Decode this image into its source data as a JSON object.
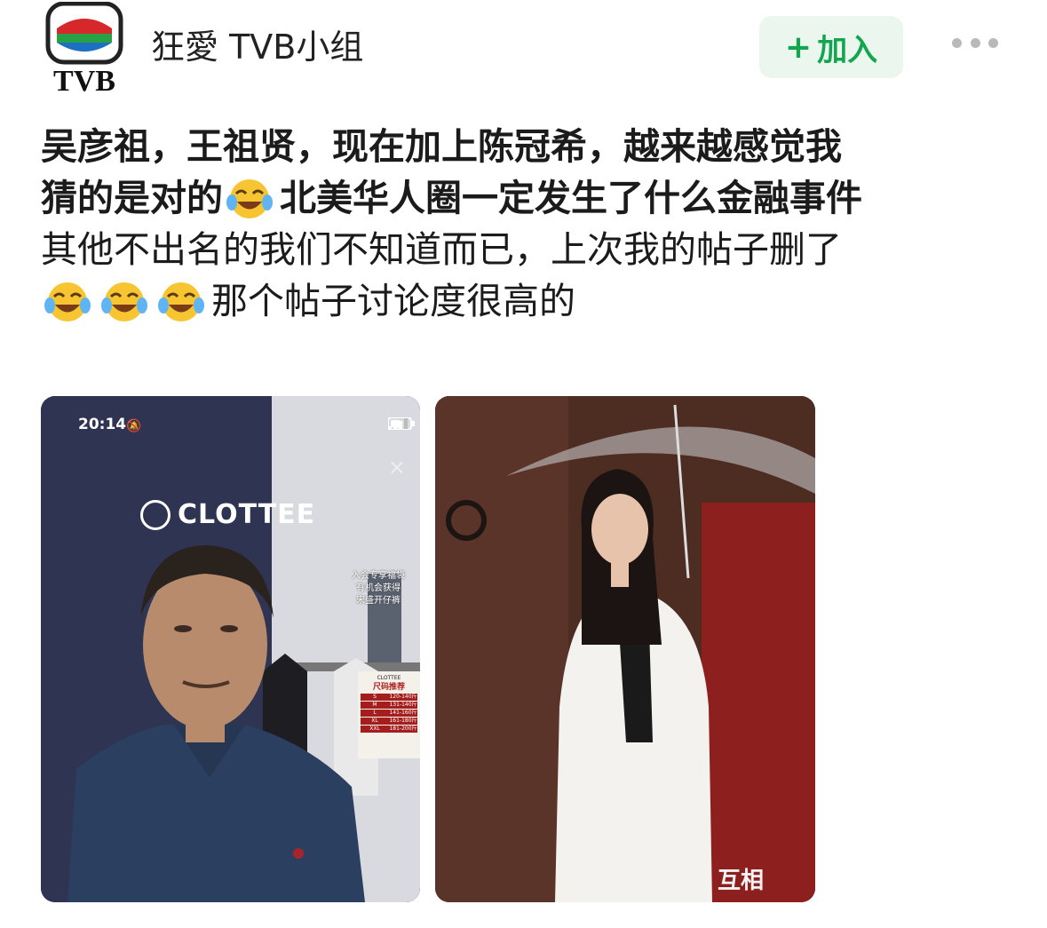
{
  "header": {
    "logo_text": "TVB",
    "group_name": "狂愛 TVB小组",
    "join_plus": "+",
    "join_label": "加入"
  },
  "post": {
    "line1": "吴彦祖，王祖贤，现在加上陈冠希，越来越感觉我",
    "line2_before": "猜的是对的",
    "line2_after": "北美华人圈一定发生了什么金融事件",
    "line3": "其他不出名的我们不知道而已，上次我的帖子删了",
    "line4_after": "那个帖子讨论度很高的",
    "emoji": "face-with-tears-of-joy-icon"
  },
  "photo1": {
    "status_time": "20:14",
    "close": "×",
    "brand": "CLOTTEE",
    "promo_lines": [
      "入会专享福袋",
      "有机会获得",
      "宋盛开仔裤"
    ],
    "size_card": {
      "brand": "CLOTTEE",
      "title": "尺码推荐",
      "rows": [
        [
          "S",
          "120-140斤"
        ],
        [
          "M",
          "131-140斤"
        ],
        [
          "L",
          "141-160斤"
        ],
        [
          "XL",
          "161-180斤"
        ],
        [
          "XXL",
          "181-200斤"
        ]
      ]
    }
  },
  "photo2": {
    "watermark": "互相"
  },
  "colors": {
    "join_bg": "#eaf6ee",
    "join_text": "#14a550",
    "more_dots": "#b9b9b9",
    "text": "#1b1b1b"
  }
}
